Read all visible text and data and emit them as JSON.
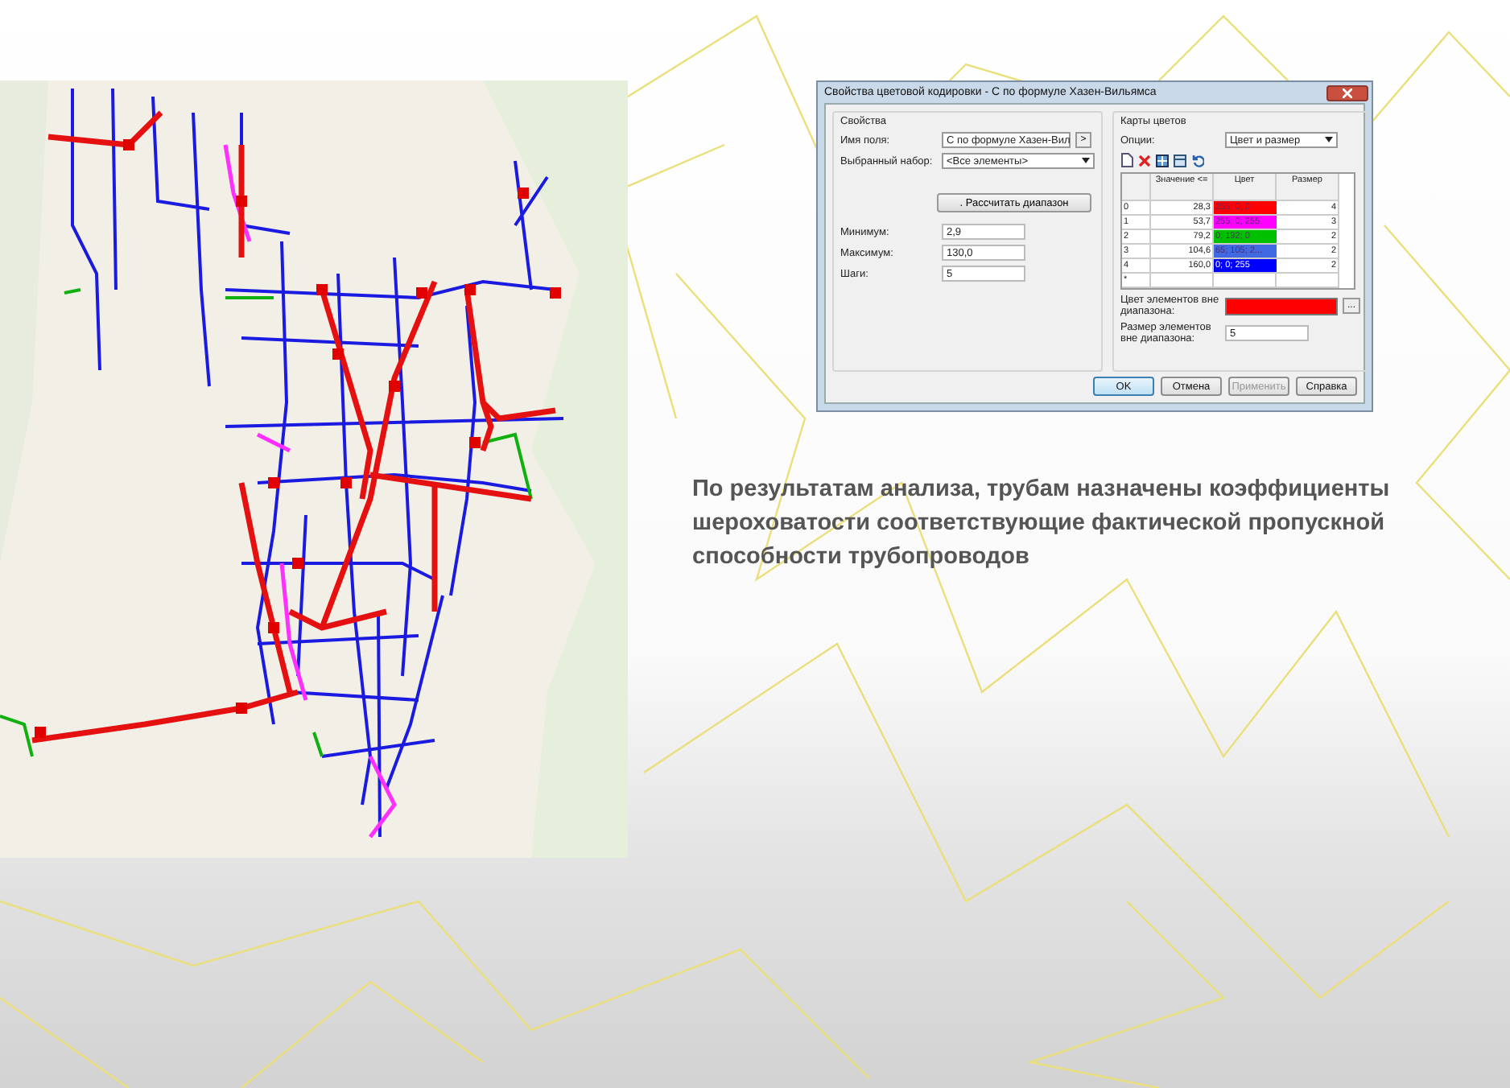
{
  "dialog": {
    "title": "Свойства цветовой кодировки - С по формуле Хазен-Вильямса",
    "properties": {
      "title": "Свойства",
      "field_label": "Имя поля:",
      "field_value": "С по формуле Хазен-Вил",
      "field_more": ">",
      "set_label": "Выбранный набор:",
      "set_value": "<Все элементы>",
      "calc_button": ". Рассчитать диапазон",
      "min_label": "Минимум:",
      "min_value": "2,9",
      "max_label": "Максимум:",
      "max_value": "130,0",
      "steps_label": "Шаги:",
      "steps_value": "5"
    },
    "color_maps": {
      "title": "Карты цветов",
      "options_label": "Опции:",
      "options_value": "Цвет и размер",
      "columns": [
        "Значение <=",
        "Цвет",
        "Размер"
      ],
      "rows": [
        {
          "index": "0",
          "value": "28,3",
          "color_text": "255; 0; 0",
          "color": "#ff0000",
          "size": "4"
        },
        {
          "index": "1",
          "value": "53,7",
          "color_text": "255; 0; 255",
          "color": "#ff00ff",
          "size": "3"
        },
        {
          "index": "2",
          "value": "79,2",
          "color_text": "0; 192; 0",
          "color": "#00c000",
          "size": "2"
        },
        {
          "index": "3",
          "value": "104,6",
          "color_text": "65; 105; 2...",
          "color": "#4169e1",
          "size": "2"
        },
        {
          "index": "4",
          "value": "160,0",
          "color_text": "0; 0; 255",
          "color": "#0000ff",
          "size": "2"
        }
      ],
      "new_row_mark": "*",
      "out_color_label": "Цвет элементов вне диапазона:",
      "out_color_button": "...",
      "out_size_label": "Размер элементов вне диапазона:",
      "out_size_value": "5"
    },
    "buttons": [
      {
        "label": "OK",
        "kind": "default"
      },
      {
        "label": "Отмена",
        "kind": "normal"
      },
      {
        "label": "Применить",
        "kind": "disabled"
      },
      {
        "label": "Справка",
        "kind": "normal"
      }
    ]
  },
  "caption": "По результатам анализа, трубам назначены коэффициенты шероховатости соответствующие фактической пропускной способности трубопроводов"
}
